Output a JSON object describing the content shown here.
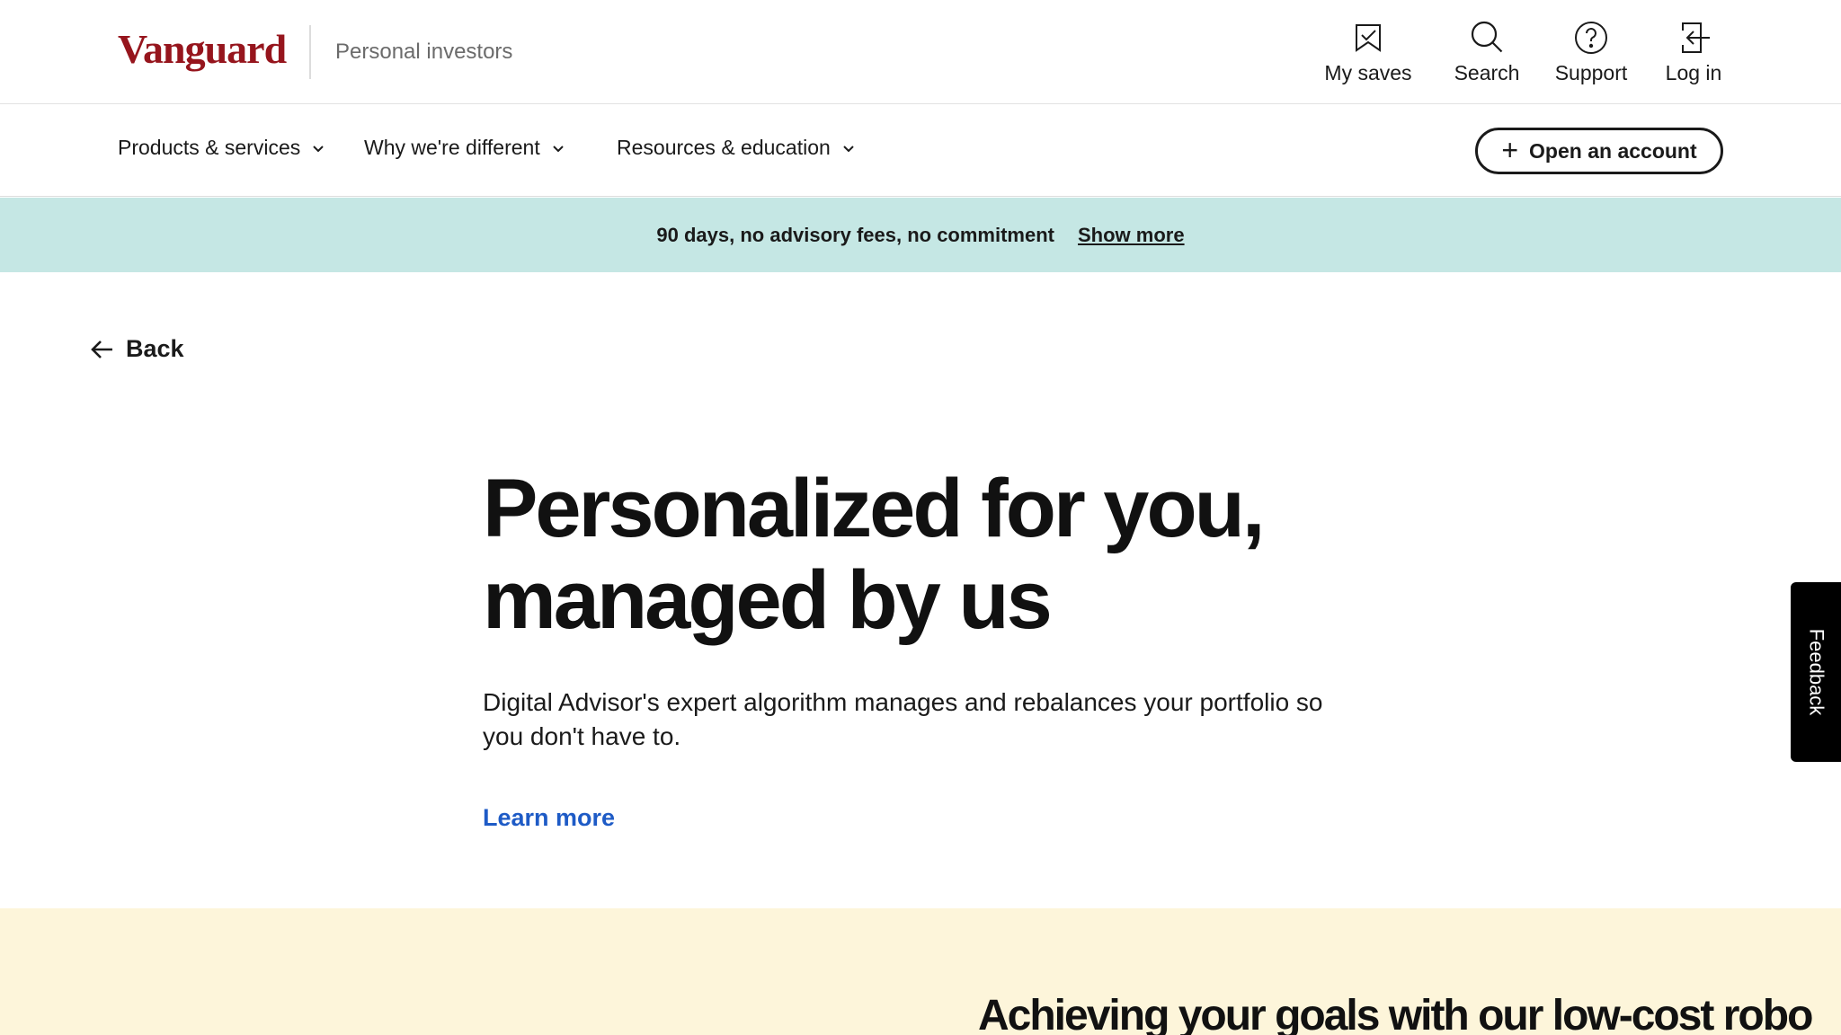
{
  "header": {
    "logo_text": "Vanguard",
    "site_label": "Personal investors",
    "utilities": {
      "saves": "My saves",
      "search": "Search",
      "support": "Support",
      "login": "Log in"
    }
  },
  "nav": {
    "items": [
      {
        "label": "Products & services"
      },
      {
        "label": "Why we're different"
      },
      {
        "label": "Resources & education"
      }
    ],
    "cta_label": "Open an account"
  },
  "promo": {
    "text": "90 days, no advisory fees, no commitment",
    "link": "Show more"
  },
  "back_label": "Back",
  "hero": {
    "title_line1": "Personalized for you,",
    "title_line2": "managed by us",
    "description": "Digital Advisor's expert algorithm manages and rebalances your portfolio so you don't have to.",
    "link": "Learn more"
  },
  "feedback_label": "Feedback",
  "section2": {
    "title": "Achieving your goals with our low-cost robo"
  },
  "colors": {
    "brand": "#96151d",
    "promo_bg": "#c5e7e4",
    "link": "#1e5bc6",
    "section_bg": "#fdf5da"
  }
}
